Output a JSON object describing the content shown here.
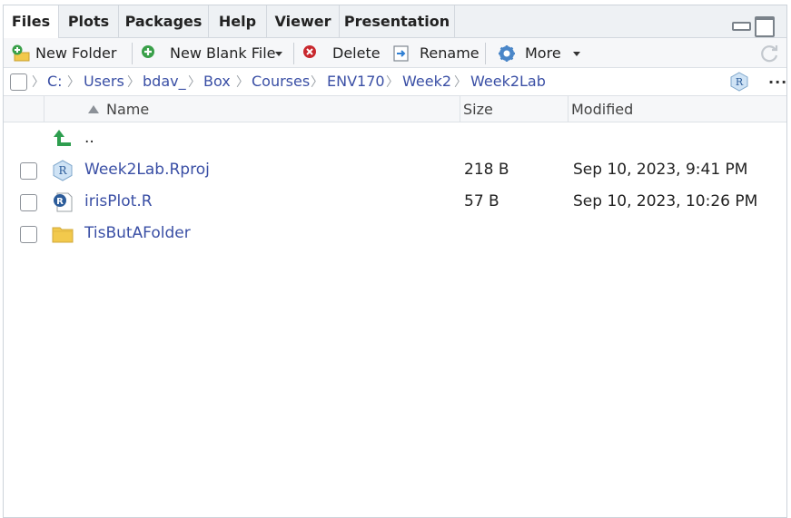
{
  "tabs": [
    {
      "label": "Files",
      "active": true
    },
    {
      "label": "Plots",
      "active": false
    },
    {
      "label": "Packages",
      "active": false
    },
    {
      "label": "Help",
      "active": false
    },
    {
      "label": "Viewer",
      "active": false
    },
    {
      "label": "Presentation",
      "active": false
    }
  ],
  "toolbar": {
    "new_folder": "New Folder",
    "new_blank_file": "New Blank File",
    "delete": "Delete",
    "rename": "Rename",
    "more": "More"
  },
  "breadcrumb": [
    "C:",
    "Users",
    "bdav_",
    "Box",
    "Courses",
    "ENV170",
    "Week2",
    "Week2Lab"
  ],
  "more_menu": "...",
  "columns": {
    "name": "Name",
    "size": "Size",
    "modified": "Modified"
  },
  "parent_dir": "..",
  "files": [
    {
      "name": "Week2Lab.Rproj",
      "size": "218 B",
      "modified": "Sep 10, 2023, 9:41 PM",
      "icon": "rproj-icon"
    },
    {
      "name": "irisPlot.R",
      "size": "57 B",
      "modified": "Sep 10, 2023, 10:26 PM",
      "icon": "r-script-icon"
    },
    {
      "name": "TisButAFolder",
      "size": "",
      "modified": "",
      "icon": "folder-icon"
    }
  ],
  "colors": {
    "link": "#3a4fa5",
    "tabbar_bg": "#eef1f4",
    "toolbar_bg": "#f6f7f9",
    "new_icon_green": "#3aa04a",
    "delete_red": "#c8282e",
    "folder_yellow": "#f2c94c",
    "up_arrow_green": "#2e9e4f"
  }
}
